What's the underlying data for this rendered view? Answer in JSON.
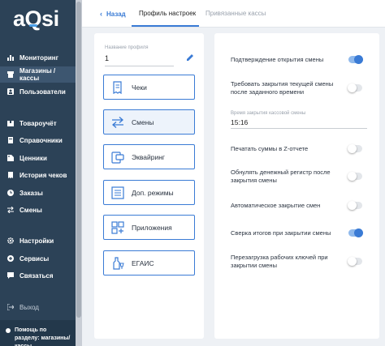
{
  "sidebar": {
    "logo": "aQsi",
    "items": [
      {
        "label": "Мониторинг",
        "icon": "chart-icon"
      },
      {
        "label": "Магазины / кассы",
        "icon": "store-icon",
        "active": true
      },
      {
        "label": "Пользователи",
        "icon": "user-icon"
      },
      {
        "label": "Товароучёт",
        "icon": "box-icon"
      },
      {
        "label": "Справочники",
        "icon": "book-icon"
      },
      {
        "label": "Ценники",
        "icon": "tag-icon"
      },
      {
        "label": "История чеков",
        "icon": "receipt-icon"
      },
      {
        "label": "Заказы",
        "icon": "clock-icon"
      },
      {
        "label": "Смены",
        "icon": "swap-icon"
      },
      {
        "label": "Настройки",
        "icon": "gear-icon"
      },
      {
        "label": "Сервисы",
        "icon": "plus-circle-icon"
      },
      {
        "label": "Связаться",
        "icon": "chat-icon"
      }
    ],
    "logout": "Выход",
    "help": "Помощь по разделу: магазины/кассы"
  },
  "topbar": {
    "back": "Назад",
    "tabs": [
      "Профиль настроек",
      "Привязанные кассы"
    ]
  },
  "profile": {
    "name_label": "Название профиля",
    "name_value": "1"
  },
  "modules": [
    {
      "label": "Чеки",
      "icon": "receipt-icon"
    },
    {
      "label": "Смены",
      "icon": "swap-arrows-icon",
      "selected": true
    },
    {
      "label": "Эквайринг",
      "icon": "card-terminal-icon"
    },
    {
      "label": "Доп. режимы",
      "icon": "list-icon"
    },
    {
      "label": "Приложения",
      "icon": "apps-grid-icon"
    },
    {
      "label": "ЕГАИС",
      "icon": "bottle-icon"
    }
  ],
  "settings": [
    {
      "label": "Подтверждение открытия смены",
      "on": true
    },
    {
      "label": "Требовать закрытия текущей смены после заданного времени",
      "on": false
    },
    {
      "label": "Печатать суммы в Z-отчете",
      "on": false
    },
    {
      "label": "Обнулять денежный регистр после закрытия смены",
      "on": false
    },
    {
      "label": "Автоматическое закрытие смен",
      "on": false
    },
    {
      "label": "Сверка итогов при закрытии смены",
      "on": true
    },
    {
      "label": "Перезагрузка рабочих ключей при закрытии смены",
      "on": false
    }
  ],
  "close_time": {
    "label": "Время закрытия кассовой смены",
    "value": "15:16"
  },
  "colors": {
    "sidebar": "#2c4257",
    "accent": "#3a7bd5"
  }
}
